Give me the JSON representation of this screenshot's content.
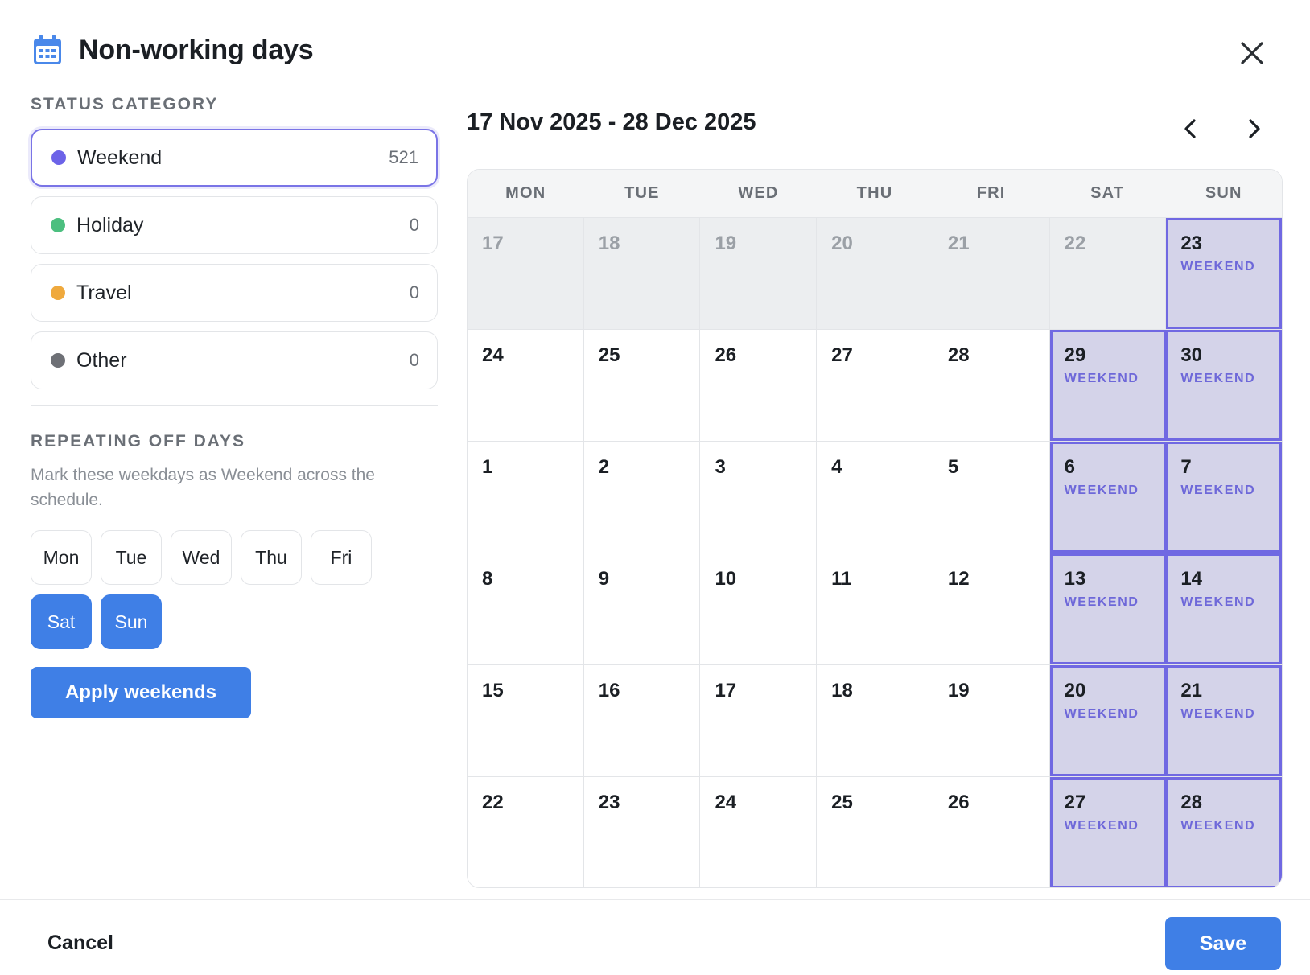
{
  "dialog": {
    "title": "Non-working days",
    "header_icon": "calendar-icon",
    "close_icon": "close-icon"
  },
  "status_category": {
    "label": "STATUS CATEGORY",
    "items": [
      {
        "label": "Weekend",
        "count": "521",
        "color": "#6c63e8",
        "selected": true
      },
      {
        "label": "Holiday",
        "count": "0",
        "color": "#4cbf7f",
        "selected": false
      },
      {
        "label": "Travel",
        "count": "0",
        "color": "#efa93d",
        "selected": false
      },
      {
        "label": "Other",
        "count": "0",
        "color": "#6e7076",
        "selected": false
      }
    ]
  },
  "repeating": {
    "label": "REPEATING OFF DAYS",
    "description": "Mark these weekdays as Weekend across the schedule.",
    "weekdays": [
      {
        "label": "Mon",
        "active": false
      },
      {
        "label": "Tue",
        "active": false
      },
      {
        "label": "Wed",
        "active": false
      },
      {
        "label": "Thu",
        "active": false
      },
      {
        "label": "Fri",
        "active": false
      },
      {
        "label": "Sat",
        "active": true
      },
      {
        "label": "Sun",
        "active": true
      }
    ],
    "apply_label": "Apply weekends"
  },
  "calendar": {
    "range_title": "17 Nov 2025 - 28 Dec 2025",
    "prev_icon": "chevron-left-icon",
    "next_icon": "chevron-right-icon",
    "weekday_headers": [
      "MON",
      "TUE",
      "WED",
      "THU",
      "FRI",
      "SAT",
      "SUN"
    ],
    "weeks": [
      [
        {
          "day": "17",
          "outside": true,
          "tag": ""
        },
        {
          "day": "18",
          "outside": true,
          "tag": ""
        },
        {
          "day": "19",
          "outside": true,
          "tag": ""
        },
        {
          "day": "20",
          "outside": true,
          "tag": ""
        },
        {
          "day": "21",
          "outside": true,
          "tag": ""
        },
        {
          "day": "22",
          "outside": true,
          "tag": ""
        },
        {
          "day": "23",
          "outside": false,
          "tag": "WEEKEND"
        }
      ],
      [
        {
          "day": "24",
          "outside": false,
          "tag": ""
        },
        {
          "day": "25",
          "outside": false,
          "tag": ""
        },
        {
          "day": "26",
          "outside": false,
          "tag": ""
        },
        {
          "day": "27",
          "outside": false,
          "tag": ""
        },
        {
          "day": "28",
          "outside": false,
          "tag": ""
        },
        {
          "day": "29",
          "outside": false,
          "tag": "WEEKEND"
        },
        {
          "day": "30",
          "outside": false,
          "tag": "WEEKEND"
        }
      ],
      [
        {
          "day": "1",
          "outside": false,
          "tag": ""
        },
        {
          "day": "2",
          "outside": false,
          "tag": ""
        },
        {
          "day": "3",
          "outside": false,
          "tag": ""
        },
        {
          "day": "4",
          "outside": false,
          "tag": ""
        },
        {
          "day": "5",
          "outside": false,
          "tag": ""
        },
        {
          "day": "6",
          "outside": false,
          "tag": "WEEKEND"
        },
        {
          "day": "7",
          "outside": false,
          "tag": "WEEKEND"
        }
      ],
      [
        {
          "day": "8",
          "outside": false,
          "tag": ""
        },
        {
          "day": "9",
          "outside": false,
          "tag": ""
        },
        {
          "day": "10",
          "outside": false,
          "tag": ""
        },
        {
          "day": "11",
          "outside": false,
          "tag": ""
        },
        {
          "day": "12",
          "outside": false,
          "tag": ""
        },
        {
          "day": "13",
          "outside": false,
          "tag": "WEEKEND"
        },
        {
          "day": "14",
          "outside": false,
          "tag": "WEEKEND"
        }
      ],
      [
        {
          "day": "15",
          "outside": false,
          "tag": ""
        },
        {
          "day": "16",
          "outside": false,
          "tag": ""
        },
        {
          "day": "17",
          "outside": false,
          "tag": ""
        },
        {
          "day": "18",
          "outside": false,
          "tag": ""
        },
        {
          "day": "19",
          "outside": false,
          "tag": ""
        },
        {
          "day": "20",
          "outside": false,
          "tag": "WEEKEND"
        },
        {
          "day": "21",
          "outside": false,
          "tag": "WEEKEND"
        }
      ],
      [
        {
          "day": "22",
          "outside": false,
          "tag": ""
        },
        {
          "day": "23",
          "outside": false,
          "tag": ""
        },
        {
          "day": "24",
          "outside": false,
          "tag": ""
        },
        {
          "day": "25",
          "outside": false,
          "tag": ""
        },
        {
          "day": "26",
          "outside": false,
          "tag": ""
        },
        {
          "day": "27",
          "outside": false,
          "tag": "WEEKEND"
        },
        {
          "day": "28",
          "outside": false,
          "tag": "WEEKEND"
        }
      ]
    ]
  },
  "footer": {
    "cancel_label": "Cancel",
    "save_label": "Save"
  },
  "colors": {
    "accent": "#3f7fe6",
    "weekend_fill": "#d4d3e9",
    "weekend_border": "#7068e2"
  }
}
